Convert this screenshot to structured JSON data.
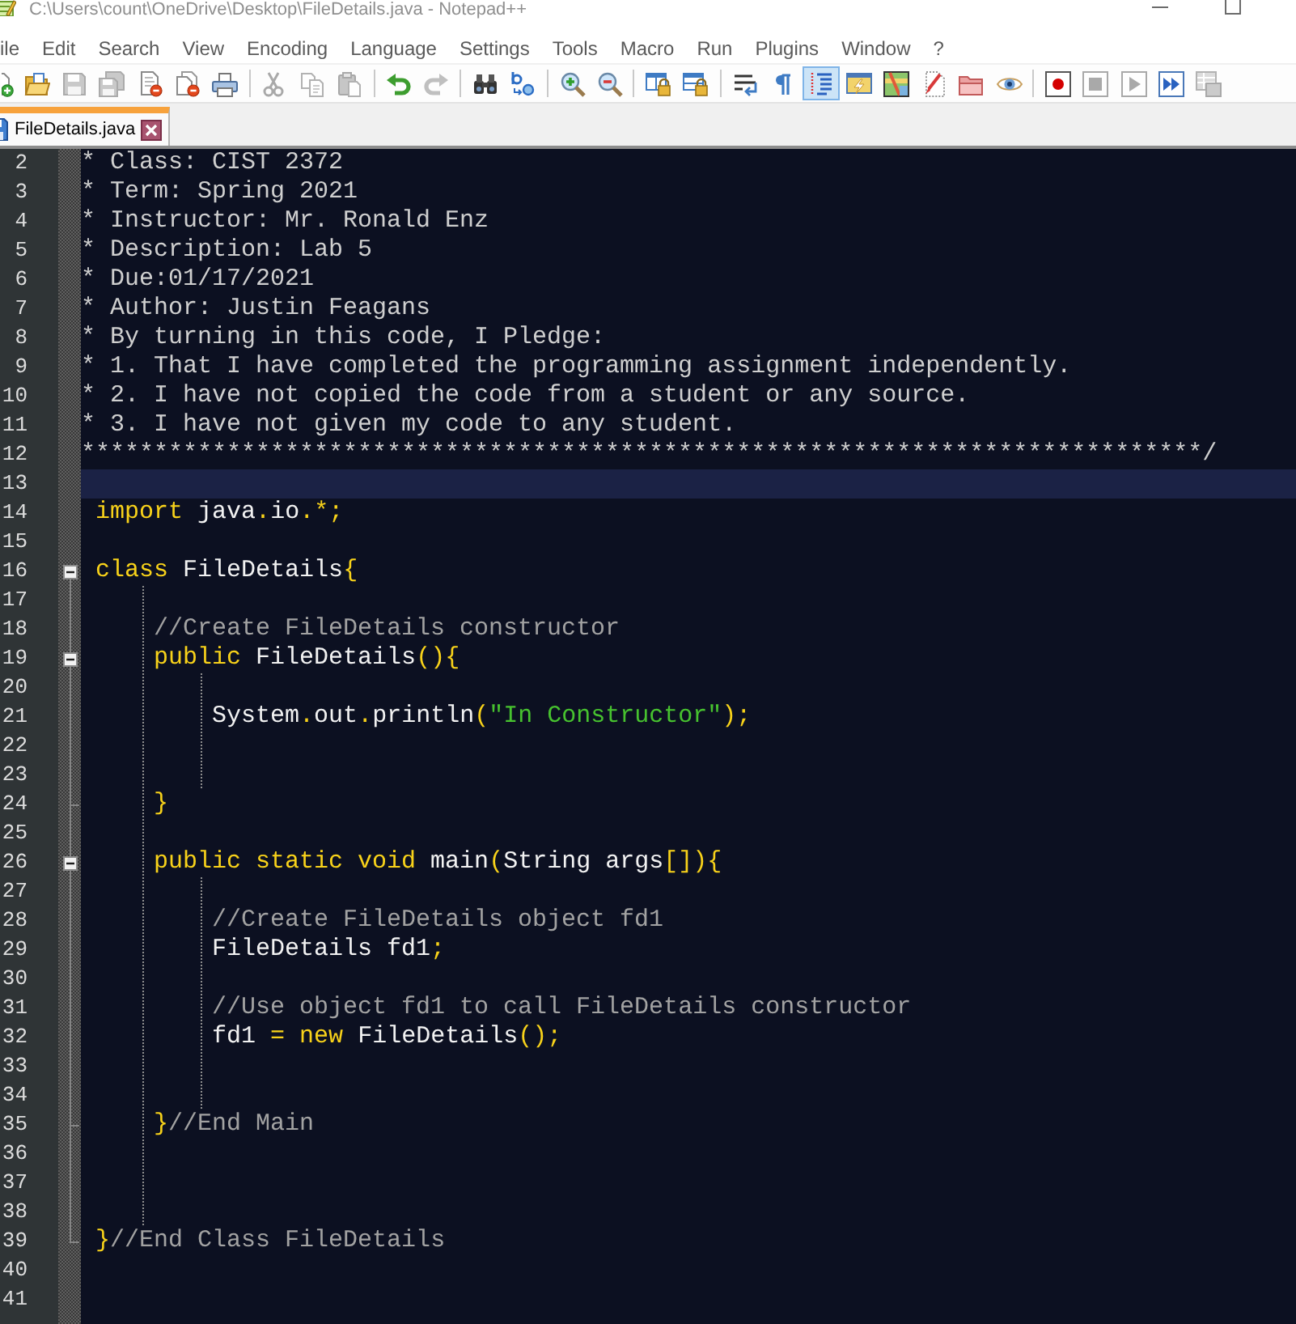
{
  "window": {
    "title": "C:\\Users\\count\\OneDrive\\Desktop\\FileDetails.java - Notepad++"
  },
  "menu": [
    "ile",
    "Edit",
    "Search",
    "View",
    "Encoding",
    "Language",
    "Settings",
    "Tools",
    "Macro",
    "Run",
    "Plugins",
    "Window",
    "?"
  ],
  "toolbar_groups": [
    {
      "buttons": [
        {
          "kind": "new",
          "on": false,
          "disabled": false
        },
        {
          "kind": "open",
          "on": false,
          "disabled": false
        },
        {
          "kind": "save",
          "on": false,
          "disabled": true
        },
        {
          "kind": "saveall",
          "on": false,
          "disabled": true
        },
        {
          "kind": "close",
          "on": false,
          "disabled": false
        },
        {
          "kind": "closeall",
          "on": false,
          "disabled": false
        },
        {
          "kind": "print",
          "on": false,
          "disabled": false
        }
      ]
    },
    {
      "buttons": [
        {
          "kind": "cut",
          "on": false,
          "disabled": true
        },
        {
          "kind": "copy",
          "on": false,
          "disabled": true
        },
        {
          "kind": "paste",
          "on": false,
          "disabled": true
        }
      ]
    },
    {
      "buttons": [
        {
          "kind": "undo",
          "on": false,
          "disabled": false
        },
        {
          "kind": "redo",
          "on": false,
          "disabled": true
        }
      ]
    },
    {
      "buttons": [
        {
          "kind": "find",
          "on": false,
          "disabled": false
        },
        {
          "kind": "replace",
          "on": false,
          "disabled": false
        }
      ]
    },
    {
      "buttons": [
        {
          "kind": "zoomin",
          "on": false,
          "disabled": false
        },
        {
          "kind": "zoomout",
          "on": false,
          "disabled": false
        }
      ]
    },
    {
      "buttons": [
        {
          "kind": "syncv",
          "on": false,
          "disabled": false
        },
        {
          "kind": "synch",
          "on": false,
          "disabled": false
        }
      ]
    },
    {
      "buttons": [
        {
          "kind": "wrap",
          "on": false,
          "disabled": false
        },
        {
          "kind": "allchars",
          "on": false,
          "disabled": false
        },
        {
          "kind": "indentguide",
          "on": true,
          "disabled": false
        },
        {
          "kind": "udl",
          "on": false,
          "disabled": false
        },
        {
          "kind": "docmap",
          "on": false,
          "disabled": false
        },
        {
          "kind": "functionlist",
          "on": false,
          "disabled": false
        },
        {
          "kind": "workspace",
          "on": false,
          "disabled": false
        },
        {
          "kind": "monitor",
          "on": false,
          "disabled": false
        }
      ]
    },
    {
      "buttons": [
        {
          "kind": "record",
          "on": false,
          "disabled": false
        },
        {
          "kind": "stop",
          "on": false,
          "disabled": true
        },
        {
          "kind": "play",
          "on": false,
          "disabled": true
        },
        {
          "kind": "playmulti",
          "on": false,
          "disabled": false
        },
        {
          "kind": "savemacro",
          "on": false,
          "disabled": true
        }
      ]
    }
  ],
  "tabs": [
    {
      "label": "FileDetails.java",
      "selected": true
    }
  ],
  "editor": {
    "lines": [
      {
        "number": "2",
        "kind": "plain",
        "current": false,
        "tokens": [
          {
            "kind": "blockcomment",
            "text": "* Class: CIST 2372"
          }
        ]
      },
      {
        "number": "3",
        "kind": "plain",
        "current": false,
        "tokens": [
          {
            "kind": "blockcomment",
            "text": "* Term: Spring 2021"
          }
        ]
      },
      {
        "number": "4",
        "kind": "plain",
        "current": false,
        "tokens": [
          {
            "kind": "blockcomment",
            "text": "* Instructor: Mr. Ronald Enz"
          }
        ]
      },
      {
        "number": "5",
        "kind": "plain",
        "current": false,
        "tokens": [
          {
            "kind": "blockcomment",
            "text": "* Description: Lab 5"
          }
        ]
      },
      {
        "number": "6",
        "kind": "plain",
        "current": false,
        "tokens": [
          {
            "kind": "blockcomment",
            "text": "* Due:01/17/2021"
          }
        ]
      },
      {
        "number": "7",
        "kind": "plain",
        "current": false,
        "tokens": [
          {
            "kind": "blockcomment",
            "text": "* Author: Justin Feagans"
          }
        ]
      },
      {
        "number": "8",
        "kind": "plain",
        "current": false,
        "tokens": [
          {
            "kind": "blockcomment",
            "text": "* By turning in this code, I Pledge:"
          }
        ]
      },
      {
        "number": "9",
        "kind": "plain",
        "current": false,
        "tokens": [
          {
            "kind": "blockcomment",
            "text": "* 1. That I have completed the programming assignment independently."
          }
        ]
      },
      {
        "number": "10",
        "kind": "plain",
        "current": false,
        "tokens": [
          {
            "kind": "blockcomment",
            "text": "* 2. I have not copied the code from a student or any source."
          }
        ]
      },
      {
        "number": "11",
        "kind": "plain",
        "current": false,
        "tokens": [
          {
            "kind": "blockcomment",
            "text": "* 3. I have not given my code to any student."
          }
        ]
      },
      {
        "number": "12",
        "kind": "plain",
        "current": false,
        "tokens": [
          {
            "kind": "blockcomment",
            "text": "*****************************************************************************/"
          }
        ]
      },
      {
        "number": "13",
        "kind": "plain",
        "current": true
      },
      {
        "number": "14",
        "kind": "plain",
        "current": false,
        "tokens": [
          {
            "kind": "keyword",
            "text": " import"
          },
          {
            "kind": "identifier",
            "text": " java"
          },
          {
            "kind": "operator",
            "text": "."
          },
          {
            "kind": "identifier",
            "text": "io"
          },
          {
            "kind": "operator",
            "text": ".*;"
          }
        ]
      },
      {
        "number": "15",
        "kind": "plain",
        "current": false
      },
      {
        "number": "16",
        "kind": "foldstart",
        "expanded": true,
        "current": false,
        "tokens": [
          {
            "kind": "keyword",
            "text": " class"
          },
          {
            "kind": "identifier",
            "text": " FileDetails"
          },
          {
            "kind": "operator",
            "text": "{"
          }
        ]
      },
      {
        "number": "17",
        "kind": "plain",
        "current": false
      },
      {
        "number": "18",
        "kind": "plain",
        "current": false,
        "tokens": [
          {
            "kind": "linecomment",
            "text": "     //Create FileDetails constructor"
          }
        ]
      },
      {
        "number": "19",
        "kind": "foldstart",
        "expanded": true,
        "current": false,
        "tokens": [
          {
            "kind": "keyword",
            "text": "     public"
          },
          {
            "kind": "identifier",
            "text": " FileDetails"
          },
          {
            "kind": "operator",
            "text": "(){"
          }
        ]
      },
      {
        "number": "20",
        "kind": "plain",
        "current": false
      },
      {
        "number": "21",
        "kind": "plain",
        "current": false,
        "tokens": [
          {
            "kind": "identifier",
            "text": "         System"
          },
          {
            "kind": "operator",
            "text": "."
          },
          {
            "kind": "identifier",
            "text": "out"
          },
          {
            "kind": "operator",
            "text": "."
          },
          {
            "kind": "identifier",
            "text": "println"
          },
          {
            "kind": "operator",
            "text": "("
          },
          {
            "kind": "string",
            "text": "\"In Constructor\""
          },
          {
            "kind": "operator",
            "text": ");"
          }
        ]
      },
      {
        "number": "22",
        "kind": "plain",
        "current": false
      },
      {
        "number": "23",
        "kind": "plain",
        "current": false
      },
      {
        "number": "24",
        "kind": "foldend",
        "current": false,
        "tokens": [
          {
            "kind": "operator",
            "text": "     }"
          }
        ]
      },
      {
        "number": "25",
        "kind": "plain",
        "current": false
      },
      {
        "number": "26",
        "kind": "foldstart",
        "expanded": true,
        "current": false,
        "tokens": [
          {
            "kind": "keyword",
            "text": "     public static void"
          },
          {
            "kind": "identifier",
            "text": " main"
          },
          {
            "kind": "operator",
            "text": "("
          },
          {
            "kind": "identifier",
            "text": "String args"
          },
          {
            "kind": "operator",
            "text": "[]){"
          }
        ]
      },
      {
        "number": "27",
        "kind": "plain",
        "current": false
      },
      {
        "number": "28",
        "kind": "plain",
        "current": false,
        "tokens": [
          {
            "kind": "linecomment",
            "text": "         //Create FileDetails object fd1"
          }
        ]
      },
      {
        "number": "29",
        "kind": "plain",
        "current": false,
        "tokens": [
          {
            "kind": "identifier",
            "text": "         FileDetails fd1"
          },
          {
            "kind": "operator",
            "text": ";"
          }
        ]
      },
      {
        "number": "30",
        "kind": "plain",
        "current": false
      },
      {
        "number": "31",
        "kind": "plain",
        "current": false,
        "tokens": [
          {
            "kind": "linecomment",
            "text": "         //Use object fd1 to call FileDetails constructor"
          }
        ]
      },
      {
        "number": "32",
        "kind": "plain",
        "current": false,
        "tokens": [
          {
            "kind": "identifier",
            "text": "         fd1"
          },
          {
            "kind": "operator",
            "text": " ="
          },
          {
            "kind": "keyword",
            "text": " new"
          },
          {
            "kind": "identifier",
            "text": " FileDetails"
          },
          {
            "kind": "operator",
            "text": "();"
          }
        ]
      },
      {
        "number": "33",
        "kind": "plain",
        "current": false
      },
      {
        "number": "34",
        "kind": "plain",
        "current": false
      },
      {
        "number": "35",
        "kind": "foldend",
        "current": false,
        "tokens": [
          {
            "kind": "operator",
            "text": "     }"
          },
          {
            "kind": "linecomment",
            "text": "//End Main"
          }
        ]
      },
      {
        "number": "36",
        "kind": "plain",
        "current": false
      },
      {
        "number": "37",
        "kind": "plain",
        "current": false
      },
      {
        "number": "38",
        "kind": "plain",
        "current": false
      },
      {
        "number": "39",
        "kind": "foldend",
        "current": false,
        "tokens": [
          {
            "kind": "operator",
            "text": " }"
          },
          {
            "kind": "linecomment",
            "text": "//End Class FileDetails"
          }
        ]
      },
      {
        "number": "40",
        "kind": "plain",
        "current": false
      },
      {
        "number": "41",
        "kind": "plain",
        "current": false
      }
    ]
  }
}
